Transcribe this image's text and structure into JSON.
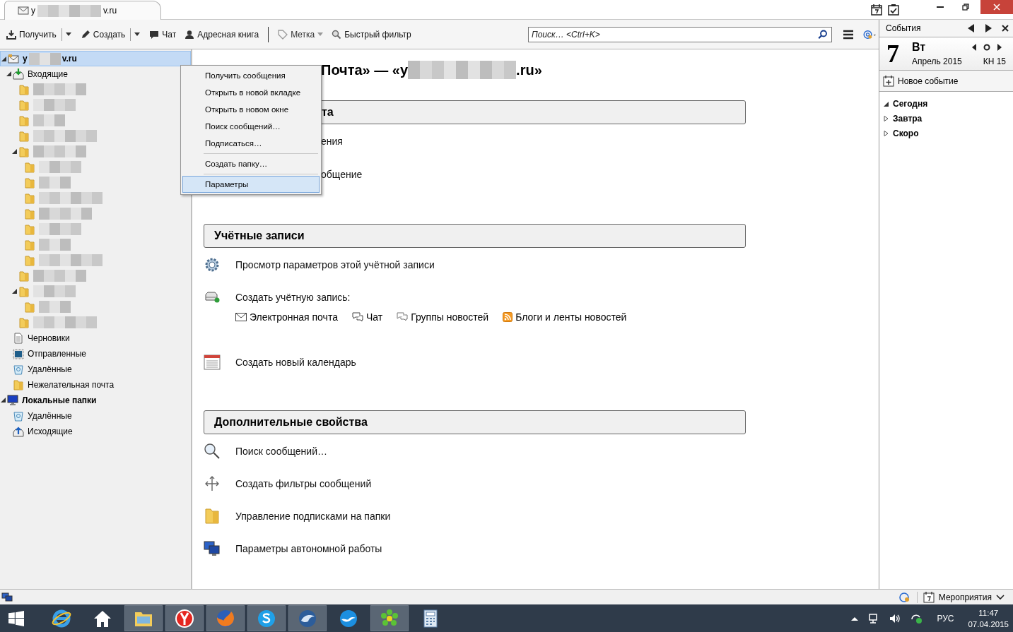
{
  "tab": {
    "title_start": "y",
    "redacted": true,
    "title_end": "v.ru"
  },
  "toolbar": {
    "buttons": [
      {
        "kind": "split",
        "label": "Получить"
      },
      {
        "kind": "split",
        "label": "Создать"
      },
      {
        "kind": "plain",
        "label": "Чат"
      },
      {
        "kind": "plain",
        "label": "Адресная книга"
      },
      {
        "kind": "menu",
        "label": "Метка"
      },
      {
        "kind": "plain",
        "label": "Быстрый фильтр"
      }
    ],
    "search": {
      "placeholder": "Поиск… <Ctrl+K>"
    }
  },
  "folders": [
    {
      "kind": "account",
      "name": "y",
      "redacted": true,
      "name_end": "v.ru",
      "selected": true,
      "expanded": true,
      "children": [
        {
          "kind": "inbox",
          "name": "Входящие",
          "selected": false,
          "expanded": true,
          "children": [
            {
              "kind": "folder",
              "redacted": true,
              "selected": false
            },
            {
              "kind": "folder",
              "redacted": true,
              "selected": false
            },
            {
              "kind": "folder",
              "redacted": true,
              "selected": false
            },
            {
              "kind": "folder",
              "redacted": true,
              "selected": false
            },
            {
              "kind": "folder",
              "redacted": true,
              "selected": false,
              "expanded": true,
              "children": [
                {
                  "kind": "folder",
                  "redacted": true,
                  "selected": false
                },
                {
                  "kind": "folder",
                  "redacted": true,
                  "selected": false
                },
                {
                  "kind": "folder",
                  "redacted": true,
                  "selected": false
                },
                {
                  "kind": "folder",
                  "redacted": true,
                  "selected": false
                },
                {
                  "kind": "folder",
                  "redacted": true,
                  "selected": false
                },
                {
                  "kind": "folder",
                  "redacted": true,
                  "selected": false
                },
                {
                  "kind": "folder",
                  "redacted": true,
                  "selected": false
                }
              ]
            },
            {
              "kind": "folder",
              "redacted": true,
              "selected": false
            },
            {
              "kind": "folder",
              "redacted": true,
              "selected": false,
              "expanded": true,
              "children": [
                {
                  "kind": "folder",
                  "redacted": true,
                  "selected": false
                }
              ]
            },
            {
              "kind": "folder",
              "redacted": true,
              "selected": false
            }
          ]
        },
        {
          "kind": "drafts",
          "name": "Черновики",
          "selected": false
        },
        {
          "kind": "sent",
          "name": "Отправленные",
          "selected": false
        },
        {
          "kind": "trash",
          "name": "Удалённые",
          "selected": false
        },
        {
          "kind": "folder",
          "name": "Нежелательная почта",
          "selected": false
        }
      ]
    },
    {
      "kind": "local",
      "name": "Локальные папки",
      "selected": false,
      "expanded": true,
      "children": [
        {
          "kind": "trash",
          "name": "Удалённые",
          "selected": false
        },
        {
          "kind": "outbox",
          "name": "Исходящие",
          "selected": false
        }
      ]
    }
  ],
  "context_menu": [
    {
      "kind": "item",
      "label": "Получить сообщения",
      "selected": false
    },
    {
      "kind": "item",
      "label": "Открыть в новой вкладке",
      "selected": false
    },
    {
      "kind": "item",
      "label": "Открыть в новом окне",
      "selected": false
    },
    {
      "kind": "item",
      "label": "Поиск сообщений…",
      "selected": false
    },
    {
      "kind": "item",
      "label": "Подписаться…",
      "selected": false
    },
    {
      "kind": "separator"
    },
    {
      "kind": "item",
      "label": "Создать папку…",
      "selected": false
    },
    {
      "kind": "separator"
    },
    {
      "kind": "item",
      "label": "Параметры",
      "selected": true
    }
  ],
  "content": {
    "title_start": "Почта» — «у",
    "redacted": true,
    "title_end": ".ru»",
    "sections": [
      {
        "kind": "covered",
        "title": "та",
        "items": [
          {
            "kind": "none",
            "label": "ения"
          },
          {
            "kind": "none",
            "label": "общение"
          }
        ]
      },
      {
        "kind": "full",
        "title": "Учётные записи",
        "items": [
          {
            "kind": "gear",
            "label": "Просмотр параметров этой учётной записи"
          },
          {
            "kind": "new-account",
            "label": "Создать учётную запись:",
            "links": [
              {
                "kind": "mail",
                "label": "Электронная почта"
              },
              {
                "kind": "chat",
                "label": "Чат"
              },
              {
                "kind": "news",
                "label": "Группы новостей"
              },
              {
                "kind": "rss",
                "label": "Блоги и ленты новостей"
              }
            ]
          },
          {
            "kind": "calendar",
            "label": "Создать новый календарь"
          }
        ]
      },
      {
        "kind": "full",
        "title": "Дополнительные свойства",
        "items": [
          {
            "kind": "search",
            "label": "Поиск сообщений…"
          },
          {
            "kind": "filter",
            "label": "Создать фильтры сообщений"
          },
          {
            "kind": "folder",
            "label": "Управление подписками на папки"
          },
          {
            "kind": "offline",
            "label": "Параметры автономной работы"
          }
        ]
      }
    ]
  },
  "events_pane": {
    "title": "События",
    "day": "7",
    "weekday": "Вт",
    "month": "Апрель 2015",
    "week": "КН 15",
    "new_event": "Новое событие",
    "groups": [
      {
        "label": "Сегодня",
        "expanded": true
      },
      {
        "label": "Завтра",
        "expanded": false
      },
      {
        "label": "Скоро",
        "expanded": false
      }
    ]
  },
  "status_bar": {
    "events_button": "Мероприятия"
  },
  "taskbar": {
    "apps": [
      {
        "kind": "ie",
        "running": false
      },
      {
        "kind": "home",
        "running": false
      },
      {
        "kind": "explorer",
        "running": true
      },
      {
        "kind": "yandex",
        "running": true
      },
      {
        "kind": "firefox",
        "running": true
      },
      {
        "kind": "skype",
        "running": true
      },
      {
        "kind": "thunderbird",
        "running": true
      },
      {
        "kind": "bird",
        "running": false
      },
      {
        "kind": "icq",
        "running": true
      },
      {
        "kind": "calculator",
        "running": false
      }
    ],
    "language": "РУС",
    "time": "11:47",
    "date": "07.04.2015"
  }
}
